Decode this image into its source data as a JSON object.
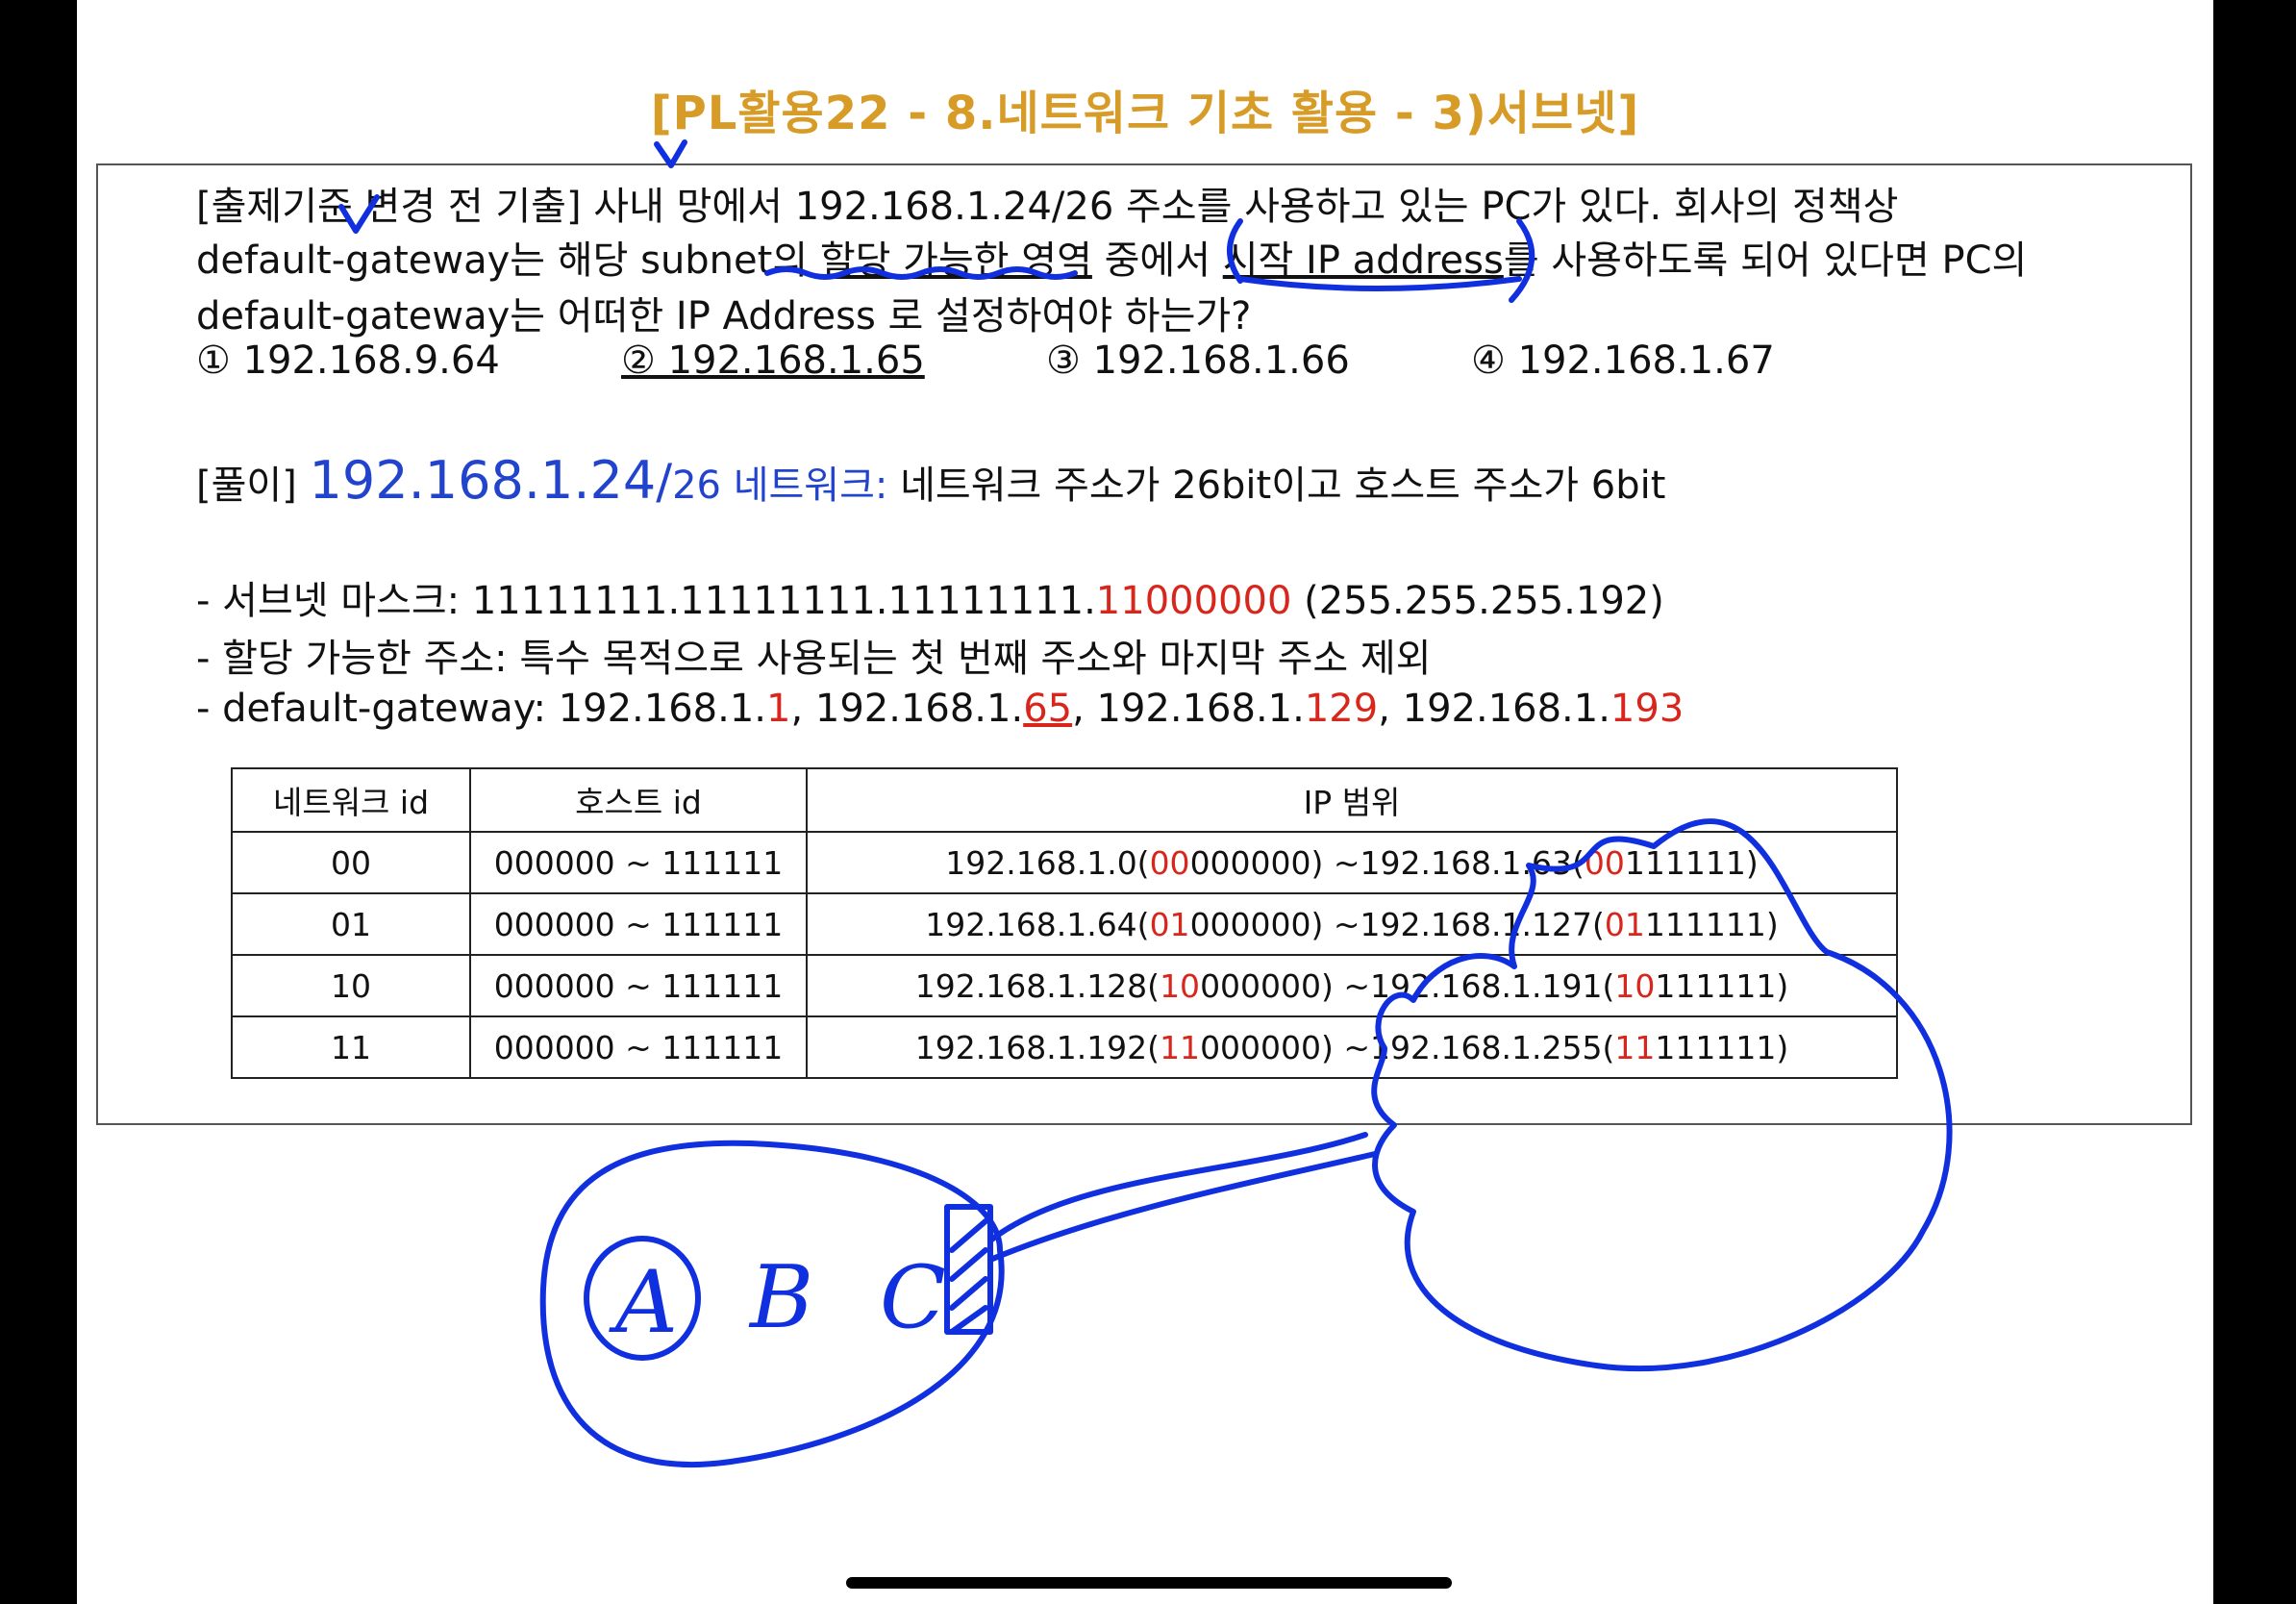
{
  "title": "[PL활용22 - 8.네트워크 기초 활용 - 3)서브넷]",
  "question": {
    "line1": "[출제기준 변경 전 기출] 사내 망에서 192.168.1.24/26 주소를 사용하고 있는 PC가 있다. 회사의 정책상",
    "line2_a": "default-gateway는 해당 subnet의 ",
    "line2_b": "할당 가능한 영역",
    "line2_c": " 중에서 ",
    "line2_d": "시작 IP address",
    "line2_e": "를 사용하도록 되어 있다면 PC의",
    "line3": "default-gateway는 어떠한 IP Address 로 설정하여야 하는가?",
    "options": [
      "① 192.168.9.64",
      "② 192.168.1.65",
      "③ 192.168.1.66",
      "④ 192.168.1.67"
    ]
  },
  "solution": {
    "label": "[풀이]",
    "ip": "192.168.1.24",
    "slash": "/",
    "prefix": "26 네트워크:",
    "desc": " 네트워크 주소가 26bit이고 호스트 주소가 6bit",
    "mask_label": "- 서브넷 마스크: ",
    "mask_black": "11111111.11111111.11111111.",
    "mask_red": "11000000",
    "mask_dec": " (255.255.255.192)",
    "assign": "- 할당 가능한 주소: 특수 목적으로 사용되는 첫 번째 주소와 마지막 주소 제외",
    "gw_label": "- default-gateway: ",
    "gw_prefix": "192.168.1.",
    "gw_hosts": [
      "1",
      "65",
      "129",
      "193"
    ],
    "gw_sep": ", "
  },
  "table": {
    "headers": [
      "네트워크 id",
      "호스트 id",
      "IP 범위"
    ],
    "rows": [
      {
        "net": "00",
        "host": "000000 ~ 111111",
        "start": "192.168.1.0(",
        "s_red": "00",
        "s_rest": "000000)",
        "mid": "  ~192.168.1.63(",
        "e_red": "00",
        "e_rest": "111111)"
      },
      {
        "net": "01",
        "host": "000000 ~ 111111",
        "start": "192.168.1.64(",
        "s_red": "01",
        "s_rest": "000000)",
        "mid": "  ~192.168.1.127(",
        "e_red": "01",
        "e_rest": "111111)"
      },
      {
        "net": "10",
        "host": "000000 ~ 111111",
        "start": "192.168.1.128(",
        "s_red": "10",
        "s_rest": "000000)",
        "mid": "  ~192.168.1.191(",
        "e_red": "10",
        "e_rest": "111111)"
      },
      {
        "net": "11",
        "host": "000000 ~ 111111",
        "start": "192.168.1.192(",
        "s_red": "11",
        "s_rest": "000000)",
        "mid": "  ~192.168.1.255(",
        "e_red": "11",
        "e_rest": "111111)"
      }
    ]
  },
  "annotations": {
    "letters": [
      "A",
      "B",
      "C"
    ]
  },
  "colors": {
    "title": "#d79b27",
    "blue": "#2244cc",
    "red": "#d8261c",
    "ink": "#1030e0"
  }
}
